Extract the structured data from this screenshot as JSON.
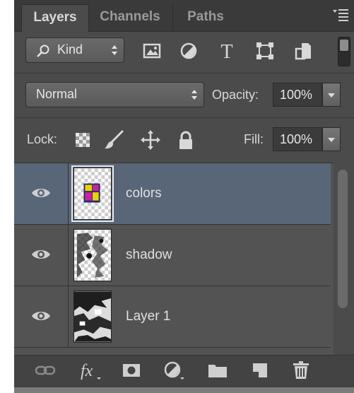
{
  "tabs": [
    {
      "label": "Layers",
      "active": true
    },
    {
      "label": "Channels",
      "active": false
    },
    {
      "label": "Paths",
      "active": false
    }
  ],
  "filter": {
    "kind_label": "Kind",
    "icons": [
      "image-filter-icon",
      "adjustment-filter-icon",
      "type-filter-icon",
      "shape-filter-icon",
      "smart-object-filter-icon"
    ]
  },
  "blend": {
    "mode": "Normal",
    "opacity_label": "Opacity:",
    "opacity_value": "100%"
  },
  "lock": {
    "label": "Lock:",
    "fill_label": "Fill:",
    "fill_value": "100%"
  },
  "layers": [
    {
      "name": "colors",
      "visible": true,
      "selected": true
    },
    {
      "name": "shadow",
      "visible": true,
      "selected": false
    },
    {
      "name": "Layer 1",
      "visible": true,
      "selected": false
    }
  ],
  "colors": {
    "panel": "#4b4b4b",
    "selected_row": "#586677",
    "text": "#e0e0e0"
  }
}
